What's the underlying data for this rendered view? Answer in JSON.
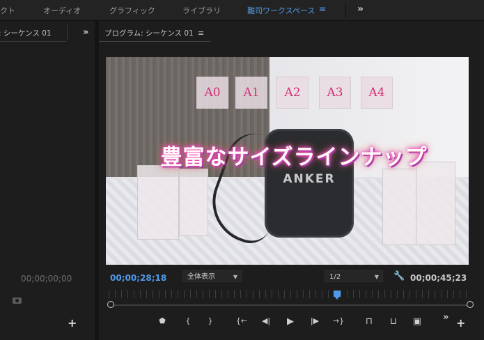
{
  "workspace_tabs": [
    {
      "label": "クト",
      "active": false
    },
    {
      "label": "オーディオ",
      "active": false
    },
    {
      "label": "グラフィック",
      "active": false
    },
    {
      "label": "ライブラリ",
      "active": false
    },
    {
      "label": "難司ワークスペース",
      "active": true
    }
  ],
  "workspace_menu_icon": "≡",
  "workspace_more_icon": "»",
  "source_panel": {
    "title": ": シーケンス 01",
    "expand_icon": "»",
    "timecode": "00;00;00;00",
    "camera_icon": "camera-icon",
    "add_icon": "+"
  },
  "program_panel": {
    "title": "プログラム: シーケンス 01",
    "menu_icon": "≡",
    "current_timecode": "00;00;28;18",
    "zoom_select": "全体表示",
    "resolution_select": "1/2",
    "duration_timecode": "00;00;45;23",
    "playhead_progress": 0.63
  },
  "video_frame": {
    "overlay_title": "豊富なサイズラインナップ",
    "size_cards": [
      "A0",
      "A1",
      "A2",
      "A3",
      "A4"
    ],
    "speaker_logo": "ANKER"
  },
  "transport": {
    "buttons": [
      {
        "name": "add-marker-button",
        "glyph": "⬟"
      },
      {
        "name": "mark-in-button",
        "glyph": "{"
      },
      {
        "name": "mark-out-button",
        "glyph": "}"
      },
      {
        "name": "go-to-in-button",
        "glyph": "{←"
      },
      {
        "name": "step-back-button",
        "glyph": "◀|"
      },
      {
        "name": "play-button",
        "glyph": "▶"
      },
      {
        "name": "step-forward-button",
        "glyph": "|▶"
      },
      {
        "name": "go-to-out-button",
        "glyph": "→}"
      },
      {
        "name": "lift-button",
        "glyph": "⊓"
      },
      {
        "name": "extract-button",
        "glyph": "⊔"
      },
      {
        "name": "export-frame-button",
        "glyph": "▣"
      }
    ],
    "more_icon": "»",
    "add_icon": "+"
  },
  "colors": {
    "accent_blue": "#4f9bea",
    "panel_bg": "#1d1d1d",
    "size_card_text": "#d52f74"
  }
}
